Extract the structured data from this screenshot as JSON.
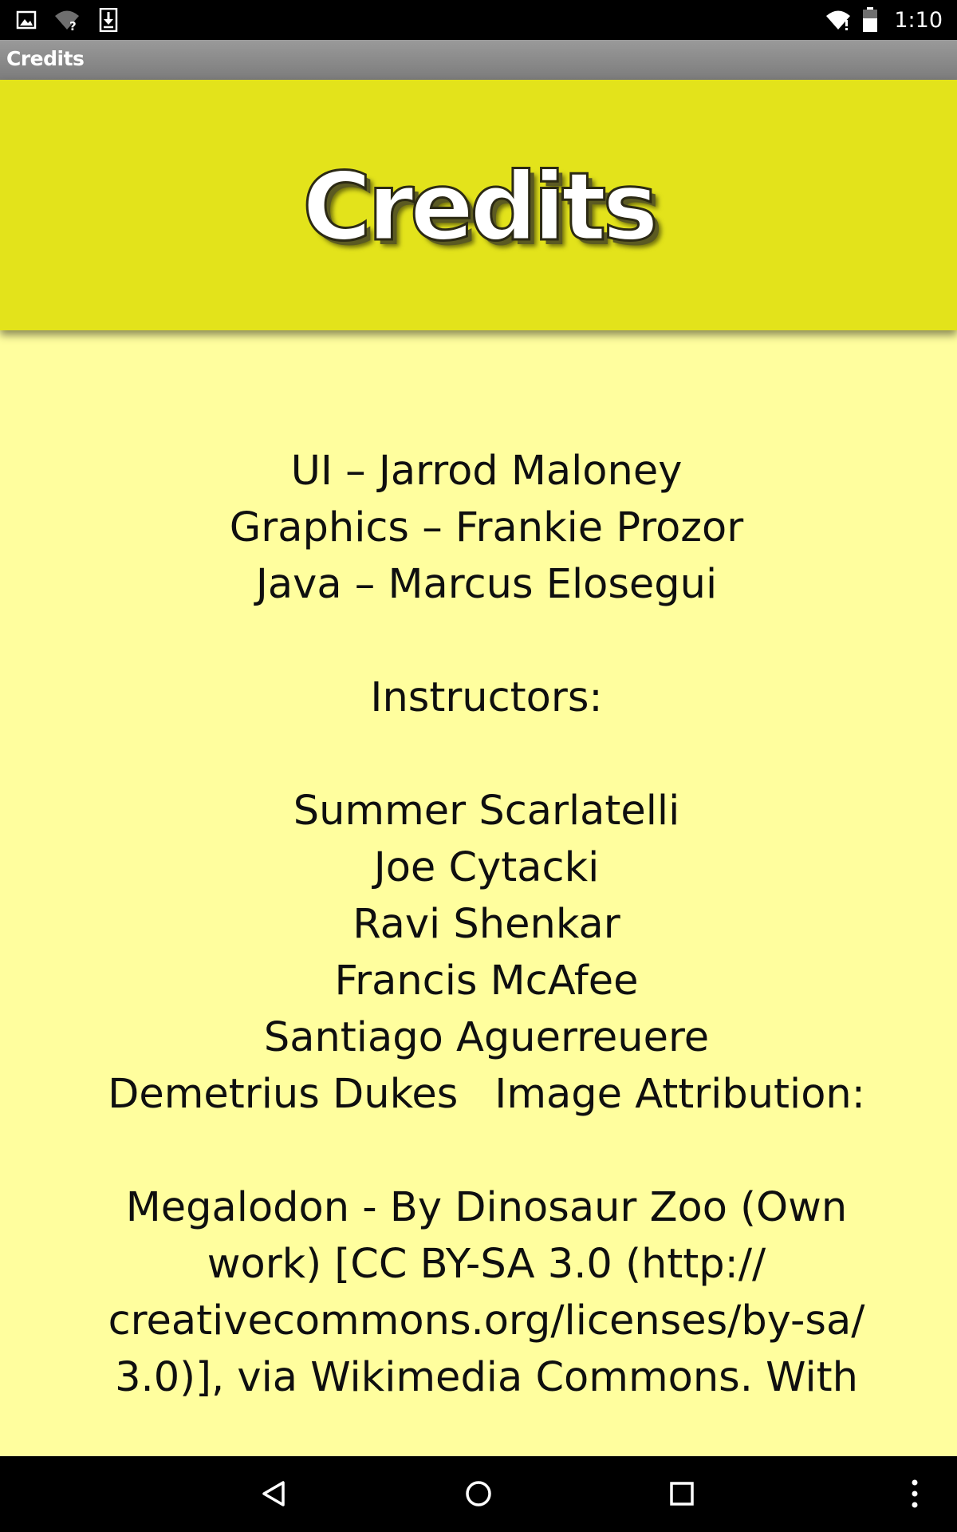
{
  "status_bar": {
    "time": "1:10",
    "icons": [
      "image-notification-icon",
      "wifi-question-icon",
      "download-icon",
      "wifi-icon",
      "battery-icon"
    ]
  },
  "action_bar": {
    "title": "Credits"
  },
  "banner": {
    "title": "Credits",
    "background_color": "#e3e31b"
  },
  "content": {
    "background_color": "#fffe9e",
    "team": [
      "UI – Jarrod Maloney",
      "Graphics – Frankie Prozor",
      "Java – Marcus Elosegui"
    ],
    "instructors_heading": "Instructors:",
    "instructors": [
      "Summer Scarlatelli",
      "Joe Cytacki",
      "Ravi Shenkar",
      "Francis McAfee",
      "Santiago Aguerreuere"
    ],
    "last_instructor": "Demetrius Dukes",
    "attribution_heading": "Image Attribution:",
    "attribution_lines": [
      "Megalodon - By Dinosaur Zoo (Own",
      "work) [CC BY-SA 3.0 (http://",
      "creativecommons.org/licenses/by-sa/",
      "3.0)], via Wikimedia Commons. With"
    ]
  },
  "nav_bar": {
    "buttons": [
      "back-icon",
      "home-icon",
      "recents-icon",
      "overflow-menu-icon"
    ]
  }
}
